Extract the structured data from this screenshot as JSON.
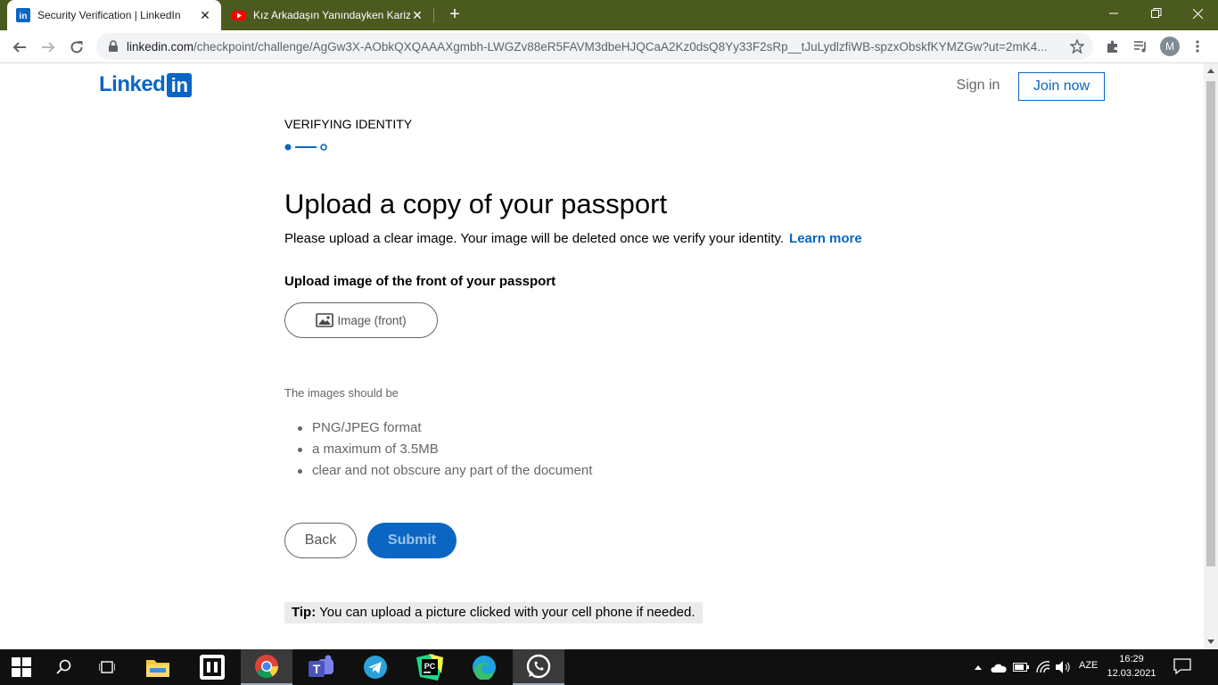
{
  "browser": {
    "tabs": [
      {
        "title": "Security Verification | LinkedIn",
        "favicon": "linkedin-icon",
        "active": true
      },
      {
        "title": "Kız Arkadaşın Yanındayken Karizma",
        "favicon": "youtube-icon",
        "active": false
      }
    ],
    "url_host": "linkedin.com",
    "url_path": "/checkpoint/challenge/AgGw3X-AObkQXQAAAXgmbh-LWGZv88eR5FAVM3dbeHJQCaA2Kz0dsQ8Yy33F2sRp__tJuLydlzfiWB-spzxObskfKYMZGw?ut=2mK4...",
    "profile_initial": "M"
  },
  "header": {
    "logo_text": "Linked",
    "logo_box": "in",
    "signin_label": "Sign in",
    "join_label": "Join now"
  },
  "main": {
    "step_label": "VERIFYING IDENTITY",
    "step_current": 1,
    "step_total": 2,
    "heading": "Upload a copy of your passport",
    "description": "Please upload a clear image. Your image will be deleted once we verify your identity.",
    "learn_more": "Learn more",
    "upload_title": "Upload image of the front of your passport",
    "upload_button": "Image (front)",
    "requirements_title": "The images should be",
    "requirements": [
      "PNG/JPEG format",
      "a maximum of 3.5MB",
      "clear and not obscure any part of the document"
    ],
    "back_label": "Back",
    "submit_label": "Submit",
    "tip_prefix": "Tip:",
    "tip_text": " You can upload a picture clicked with your cell phone if needed."
  },
  "taskbar": {
    "apps": [
      "start-icon",
      "search-icon",
      "task-view-icon",
      "file-explorer-icon",
      "jetbrains-toolbox-icon",
      "chrome-icon",
      "teams-icon",
      "telegram-icon",
      "pycharm-icon",
      "edge-icon",
      "whatsapp-icon"
    ],
    "active_app": "chrome-icon",
    "language": "AZE",
    "time": "16:29",
    "date": "12.03.2021"
  },
  "colors": {
    "brand": "#0a66c2",
    "tabbar": "#4b5a1f",
    "taskbar": "#101010"
  }
}
